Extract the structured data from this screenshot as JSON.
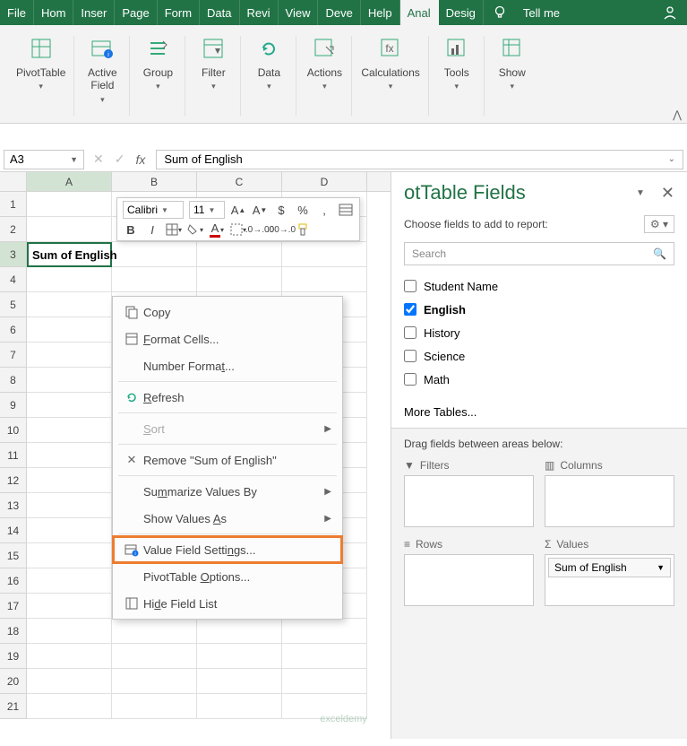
{
  "tabs": [
    "File",
    "Hom",
    "Inser",
    "Page",
    "Form",
    "Data",
    "Revi",
    "View",
    "Deve",
    "Help",
    "Anal",
    "Desig"
  ],
  "active_tab": 10,
  "tell_me": "Tell me",
  "ribbon": [
    {
      "label": "PivotTable",
      "icon": "pivot"
    },
    {
      "label": "Active\nField",
      "icon": "active-field"
    },
    {
      "label": "Group",
      "icon": "group"
    },
    {
      "label": "Filter",
      "icon": "filter"
    },
    {
      "label": "Data",
      "icon": "refresh"
    },
    {
      "label": "Actions",
      "icon": "actions"
    },
    {
      "label": "Calculations",
      "icon": "calc"
    },
    {
      "label": "Tools",
      "icon": "tools"
    },
    {
      "label": "Show",
      "icon": "show"
    }
  ],
  "name_box": "A3",
  "formula": "Sum of English",
  "col_headers": [
    "A",
    "B",
    "C",
    "D"
  ],
  "row_count": 21,
  "active_cell_value": "Sum of English",
  "font_name": "Calibri",
  "font_size": "11",
  "ctx": {
    "copy": "Copy",
    "format_cells": "Format Cells...",
    "number_format": "Number Format...",
    "refresh": "Refresh",
    "sort": "Sort",
    "remove": "Remove \"Sum of English\"",
    "summarize": "Summarize Values By",
    "show_as": "Show Values As",
    "value_field": "Value Field Settings...",
    "pivot_options": "PivotTable Options...",
    "hide": "Hide Field List"
  },
  "pane": {
    "title": "otTable Fields",
    "sub": "Choose fields to add to report:",
    "search_placeholder": "Search",
    "fields": [
      {
        "name": "Student Name",
        "checked": false
      },
      {
        "name": "English",
        "checked": true
      },
      {
        "name": "History",
        "checked": false
      },
      {
        "name": "Science",
        "checked": false
      },
      {
        "name": "Math",
        "checked": false
      }
    ],
    "more": "More Tables...",
    "drag_label": "Drag fields between areas below:",
    "filters": "Filters",
    "columns": "Columns",
    "rows": "Rows",
    "values": "Values",
    "value_pill": "Sum of English"
  },
  "watermark": "exceldemy"
}
